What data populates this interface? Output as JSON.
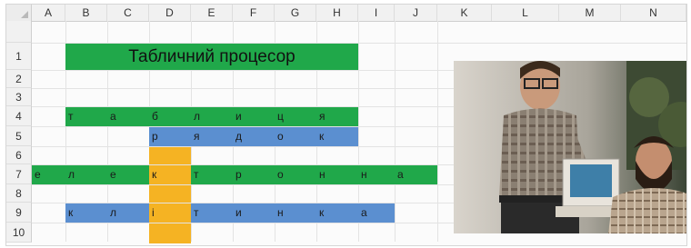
{
  "columns": [
    "A",
    "B",
    "C",
    "D",
    "E",
    "F",
    "G",
    "H",
    "I",
    "J",
    "K",
    "L",
    "M",
    "N"
  ],
  "rows": [
    "1",
    "2",
    "3",
    "4",
    "5",
    "6",
    "7",
    "8",
    "9",
    "10"
  ],
  "title": "Табличний процесор",
  "row4": [
    "т",
    "а",
    "б",
    "л",
    "и",
    "ц",
    "я"
  ],
  "row5": [
    "р",
    "я",
    "д",
    "о",
    "к"
  ],
  "row7": [
    "е",
    "л",
    "е",
    "к",
    "т",
    "р",
    "о",
    "н",
    "н",
    "а"
  ],
  "row9": [
    "к",
    "л",
    "і",
    "т",
    "и",
    "н",
    "к",
    "а"
  ],
  "colors": {
    "green": "#20a84a",
    "blue": "#5b8fd0",
    "yellow": "#f5b323"
  },
  "photo": {
    "description_icon": "photo-of-two-men-with-computer"
  }
}
